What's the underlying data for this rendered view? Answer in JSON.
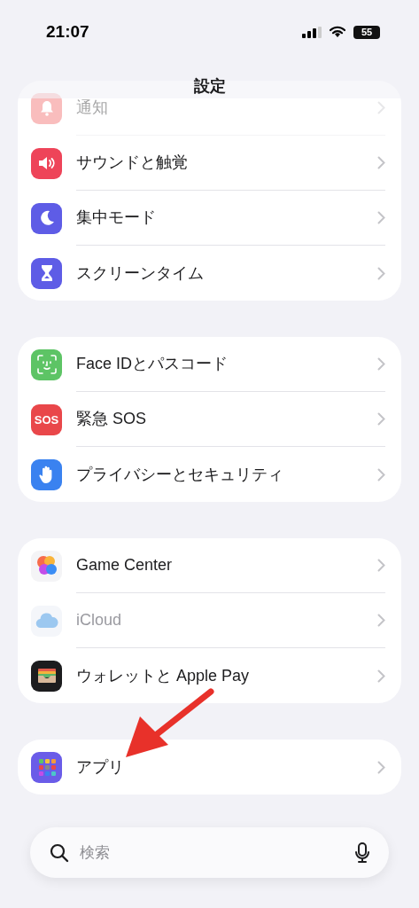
{
  "status_bar": {
    "time": "21:07",
    "battery": "55"
  },
  "title": "設定",
  "groups": [
    {
      "rows": [
        {
          "label": "通知",
          "faded": true,
          "disabled": false
        },
        {
          "label": "サウンドと触覚",
          "faded": false,
          "disabled": false
        },
        {
          "label": "集中モード",
          "faded": false,
          "disabled": false
        },
        {
          "label": "スクリーンタイム",
          "faded": false,
          "disabled": false
        }
      ]
    },
    {
      "rows": [
        {
          "label": "Face IDとパスコード",
          "faded": false,
          "disabled": false
        },
        {
          "label": "緊急 SOS",
          "icon_text": "SOS",
          "faded": false,
          "disabled": false
        },
        {
          "label": "プライバシーとセキュリティ",
          "faded": false,
          "disabled": false
        }
      ]
    },
    {
      "rows": [
        {
          "label": "Game Center",
          "faded": false,
          "disabled": false
        },
        {
          "label": "iCloud",
          "faded": false,
          "disabled": true
        },
        {
          "label": "ウォレットと Apple Pay",
          "faded": false,
          "disabled": false
        }
      ]
    },
    {
      "rows": [
        {
          "label": "アプリ",
          "faded": false,
          "disabled": false
        }
      ]
    }
  ],
  "search": {
    "placeholder": "検索"
  }
}
